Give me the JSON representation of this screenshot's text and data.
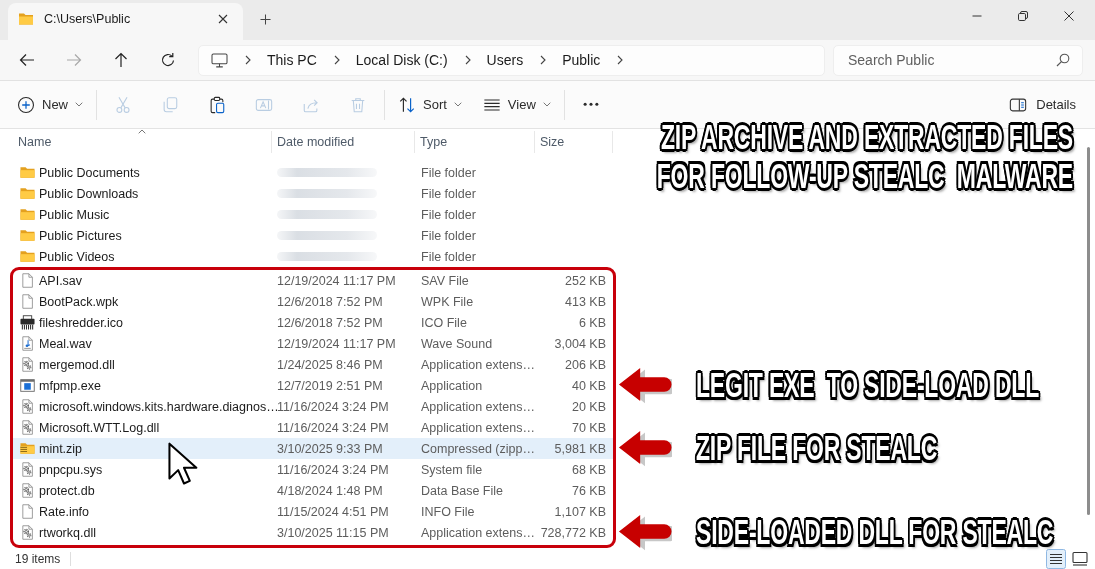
{
  "tabs": [
    {
      "title": "C:\\Users\\Public",
      "selected": true
    }
  ],
  "nav_buttons": [
    {
      "kind": "back",
      "disabled": false
    },
    {
      "kind": "forward",
      "disabled": true
    },
    {
      "kind": "up",
      "disabled": false
    },
    {
      "kind": "refresh",
      "disabled": false
    }
  ],
  "breadcrumb": [
    "This PC",
    "Local Disk (C:)",
    "Users",
    "Public"
  ],
  "search": {
    "placeholder": "Search Public"
  },
  "command_bar": {
    "items": [
      {
        "kind": "new",
        "label": "New",
        "disabled": false
      },
      {
        "kind": "cut",
        "disabled": true
      },
      {
        "kind": "copy",
        "disabled": true
      },
      {
        "kind": "paste",
        "disabled": false
      },
      {
        "kind": "rename",
        "disabled": true
      },
      {
        "kind": "share",
        "disabled": true
      },
      {
        "kind": "delete",
        "disabled": true
      },
      {
        "kind": "sort",
        "label": "Sort",
        "disabled": false
      },
      {
        "kind": "view",
        "label": "View",
        "disabled": false
      },
      {
        "kind": "more",
        "disabled": false
      }
    ],
    "details": {
      "label": "Details"
    }
  },
  "columns": [
    {
      "label": "Name",
      "sorted": true
    },
    {
      "label": "Date modified",
      "sorted": false
    },
    {
      "label": "Type",
      "sorted": false
    },
    {
      "label": "Size",
      "sorted": false
    }
  ],
  "file_list": {
    "folders": [
      {
        "kind": "folder",
        "name": "Public Documents",
        "date_blurred": true,
        "type": "File folder",
        "selected": false
      },
      {
        "kind": "folder",
        "name": "Public Downloads",
        "date_blurred": true,
        "type": "File folder",
        "selected": false
      },
      {
        "kind": "folder",
        "name": "Public Music",
        "date_blurred": true,
        "type": "File folder",
        "selected": false
      },
      {
        "kind": "folder",
        "name": "Public Pictures",
        "date_blurred": true,
        "type": "File folder",
        "selected": false
      },
      {
        "kind": "folder",
        "name": "Public Videos",
        "date_blurred": true,
        "type": "File folder",
        "selected": false
      }
    ],
    "outlined_group": {
      "outlined": true,
      "files": [
        {
          "kind": "blank",
          "name": "API.sav",
          "date_blurred": false,
          "date": "12/19/2024 11:17 PM",
          "type": "SAV File",
          "size": "252 KB",
          "selected": false
        },
        {
          "kind": "blank",
          "name": "BootPack.wpk",
          "date_blurred": false,
          "date": "12/6/2018 7:52 PM",
          "type": "WPK File",
          "size": "413 KB",
          "selected": false
        },
        {
          "kind": "shredder",
          "name": "fileshredder.ico",
          "date_blurred": false,
          "date": "12/6/2018 7:52 PM",
          "type": "ICO File",
          "size": "6 KB",
          "selected": false
        },
        {
          "kind": "audio",
          "name": "Meal.wav",
          "date_blurred": false,
          "date": "12/19/2024 11:17 PM",
          "type": "Wave Sound",
          "size": "3,004 KB",
          "selected": false
        },
        {
          "kind": "settings",
          "name": "mergemod.dll",
          "date_blurred": false,
          "date": "1/24/2025 8:46 PM",
          "type": "Application extens…",
          "size": "206 KB",
          "selected": false
        },
        {
          "kind": "app",
          "name": "mfpmp.exe",
          "date_blurred": false,
          "date": "12/7/2019 2:51 PM",
          "type": "Application",
          "size": "40 KB",
          "selected": false,
          "callout": "LEGIT EXE  TO SIDE-LOAD DLL"
        },
        {
          "kind": "settings",
          "name": "microsoft.windows.kits.hardware.diagnos…",
          "date_blurred": false,
          "date": "11/16/2024 3:24 PM",
          "type": "Application extens…",
          "size": "20 KB",
          "selected": false
        },
        {
          "kind": "settings",
          "name": "Microsoft.WTT.Log.dll",
          "date_blurred": false,
          "date": "11/16/2024 3:24 PM",
          "type": "Application extens…",
          "size": "70 KB",
          "selected": false
        },
        {
          "kind": "zip",
          "name": "mint.zip",
          "date_blurred": false,
          "date": "3/10/2025 9:33 PM",
          "type": "Compressed (zipp…",
          "size": "5,981 KB",
          "selected": true,
          "callout": "ZIP FILE FOR STEALC"
        },
        {
          "kind": "settings",
          "name": "pnpcpu.sys",
          "date_blurred": false,
          "date": "11/16/2024 3:24 PM",
          "type": "System file",
          "size": "68 KB",
          "selected": false
        },
        {
          "kind": "settings",
          "name": "protect.db",
          "date_blurred": false,
          "date": "4/18/2024 1:48 PM",
          "type": "Data Base File",
          "size": "76 KB",
          "selected": false
        },
        {
          "kind": "blank",
          "name": "Rate.info",
          "date_blurred": false,
          "date": "11/15/2024 4:51 PM",
          "type": "INFO File",
          "size": "1,107 KB",
          "selected": false
        },
        {
          "kind": "settings",
          "name": "rtworkq.dll",
          "date_blurred": false,
          "date": "3/10/2025 11:15 PM",
          "type": "Application extens…",
          "size": "728,772 KB",
          "selected": false,
          "callout": "SIDE-LOADED DLL FOR STEALC"
        }
      ]
    }
  },
  "annotation_title": [
    "ZIP ARCHIVE AND EXTRACTED FILES",
    "FOR FOLLOW-UP STEALC  MALWARE"
  ],
  "status_bar": {
    "item_count": "19 items",
    "view_modes": [
      {
        "kind": "details",
        "selected": true
      },
      {
        "kind": "tiles",
        "selected": false
      }
    ]
  }
}
